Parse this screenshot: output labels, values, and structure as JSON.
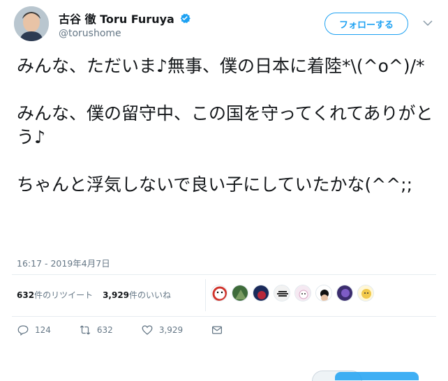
{
  "user": {
    "display_name": "古谷 徹 Toru Furuya",
    "handle": "@torushome",
    "verified": true
  },
  "follow_button": {
    "label": "フォローする"
  },
  "tweet": {
    "text": "みんな、ただいま♪無事、僕の日本に着陸*\\(^o^)/*\n\nみんな、僕の留守中、この国を守ってくれてありがとう♪\n\nちゃんと浮気しないで良い子にしていたかな(^^;;",
    "timestamp": "16:17 - 2019年4月7日"
  },
  "stats": {
    "retweets_count": "632",
    "retweets_label": "件のリツイート",
    "likes_count": "3,929",
    "likes_label": "件のいいね"
  },
  "actions": {
    "reply_count": "124",
    "retweet_count": "632",
    "like_count": "3,929"
  },
  "icons": {
    "verified": "verified-badge-icon",
    "chevron": "chevron-down-icon",
    "reply": "reply-icon",
    "retweet": "retweet-icon",
    "like": "heart-icon",
    "dm": "envelope-icon"
  },
  "colors": {
    "accent": "#1da1f2",
    "text": "#14171a",
    "muted": "#657786"
  }
}
